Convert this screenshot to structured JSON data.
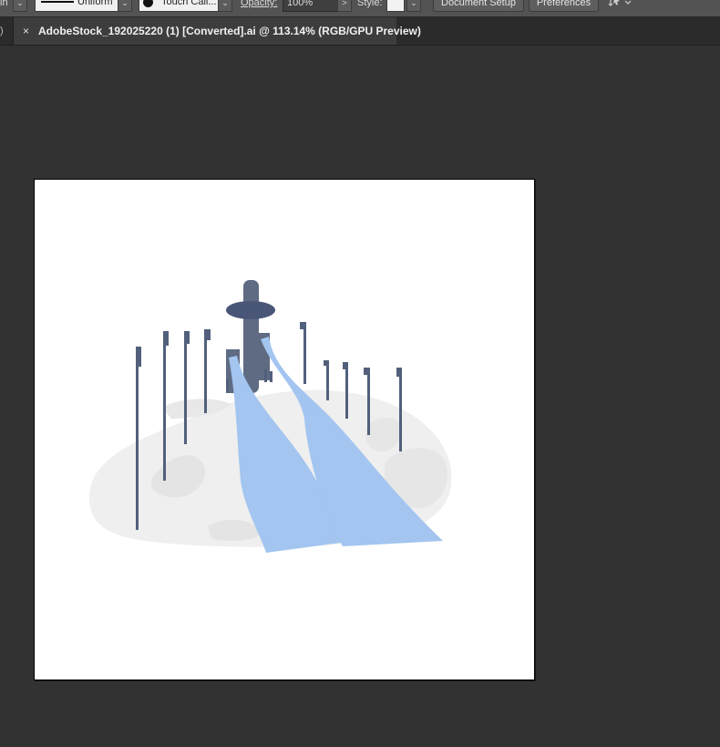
{
  "control_bar": {
    "left_clipped_text": "in",
    "stroke_profile": "Uniform",
    "brush": "Touch Call...",
    "opacity_label": "Opacity:",
    "opacity_value": "100%",
    "opacity_arrow": ">",
    "style_label": "Style:",
    "document_setup": "Document Setup",
    "preferences": "Preferences",
    "dropdown_glyph": "⌄"
  },
  "tabs": {
    "previous_tab_fragment": ")",
    "active": {
      "close_glyph": "×",
      "title": "AdobeStock_192025220 (1) [Converted].ai @ 113.14% (RGB/GPU Preview)"
    }
  },
  "icons": {
    "arrange": "arrange-documents-icon",
    "close": "close-icon"
  },
  "colors": {
    "app_bg": "#323232",
    "control_bar_bg": "#535353",
    "tab_bar_bg": "#2b2b2b",
    "active_tab_bg": "#3d3d3d",
    "artboard_bg": "#ffffff",
    "pole_color": "#52607c",
    "tower_color": "#5f6b82",
    "tower_disc": "#4a5678",
    "ramp_color": "#a3c5f0",
    "hill_color": "#efefef",
    "hill_shadow": "#e4e4e4"
  }
}
